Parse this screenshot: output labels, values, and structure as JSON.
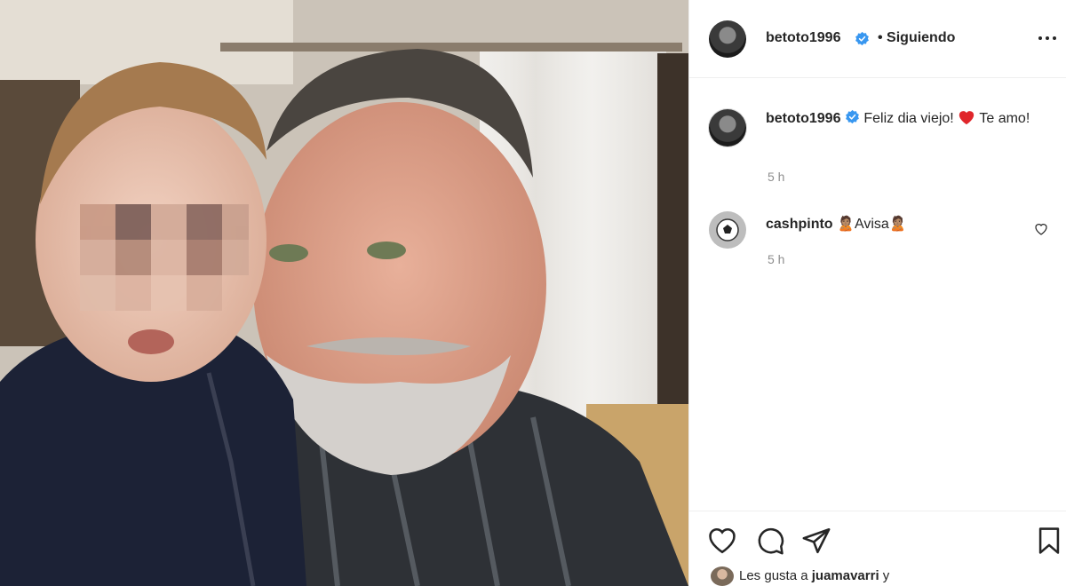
{
  "post": {
    "owner": {
      "username": "betoto1996",
      "verified": true,
      "follow_status": "Siguiendo"
    },
    "caption": {
      "username": "betoto1996",
      "text_part1": "Feliz dia viejo!",
      "emoji": "❤️",
      "text_part2": "Te amo!",
      "time": "5 h"
    },
    "comments": [
      {
        "username": "cashpinto",
        "text": "🙎🏽Avisa🙎🏽",
        "time": "5 h",
        "avatar": "soccer-ball"
      }
    ],
    "likes": {
      "prefix": "Les gusta a",
      "user": "juamavarri",
      "suffix": "y"
    }
  },
  "colors": {
    "verified": "#3897f0",
    "text": "#262626",
    "muted": "#8e8e8e",
    "heart": "#ed4956"
  }
}
